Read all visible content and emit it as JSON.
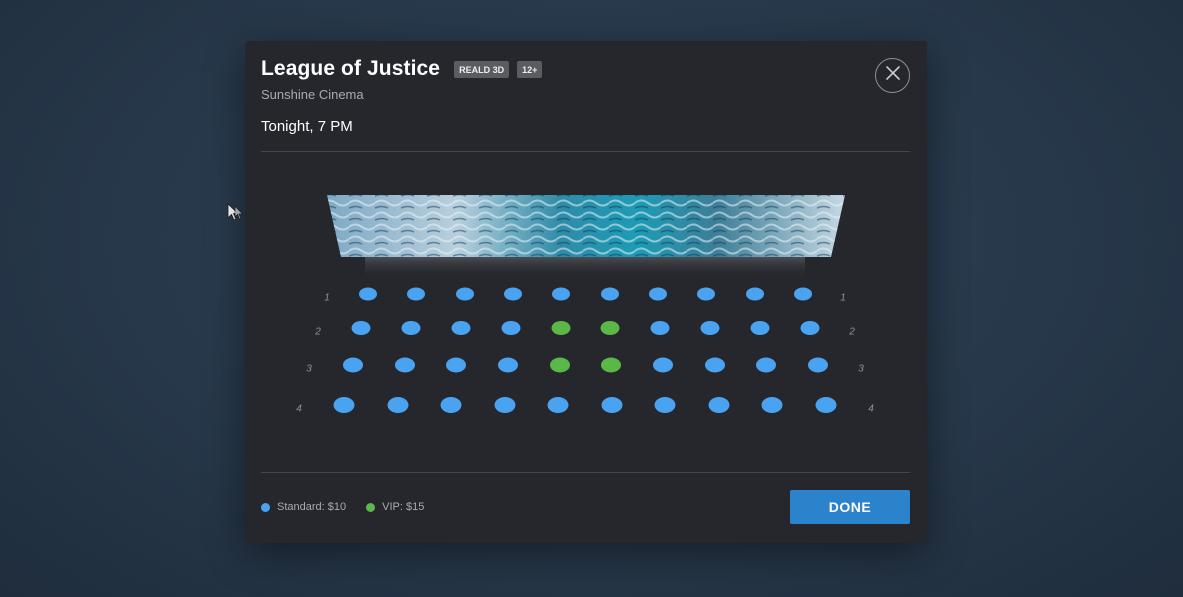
{
  "movie": {
    "title": "League of Justice",
    "badges": [
      "REALD 3D",
      "12+"
    ],
    "cinema": "Sunshine Cinema",
    "showtime": "Tonight, 7 PM"
  },
  "seating": {
    "rows": [
      {
        "label": "1",
        "seats": [
          "standard",
          "standard",
          "standard",
          "standard",
          "standard",
          "standard",
          "standard",
          "standard",
          "standard",
          "standard"
        ]
      },
      {
        "label": "2",
        "seats": [
          "standard",
          "standard",
          "standard",
          "standard",
          "vip",
          "vip",
          "standard",
          "standard",
          "standard",
          "standard"
        ]
      },
      {
        "label": "3",
        "seats": [
          "standard",
          "standard",
          "standard",
          "standard",
          "vip",
          "vip",
          "standard",
          "standard",
          "standard",
          "standard"
        ]
      },
      {
        "label": "4",
        "seats": [
          "standard",
          "standard",
          "standard",
          "standard",
          "standard",
          "standard",
          "standard",
          "standard",
          "standard",
          "standard"
        ]
      }
    ]
  },
  "legend": {
    "standard": {
      "label": "Standard: $10",
      "color": "#4aa3f0"
    },
    "vip": {
      "label": "VIP: $15",
      "color": "#5cb749"
    }
  },
  "actions": {
    "done_label": "DONE"
  }
}
